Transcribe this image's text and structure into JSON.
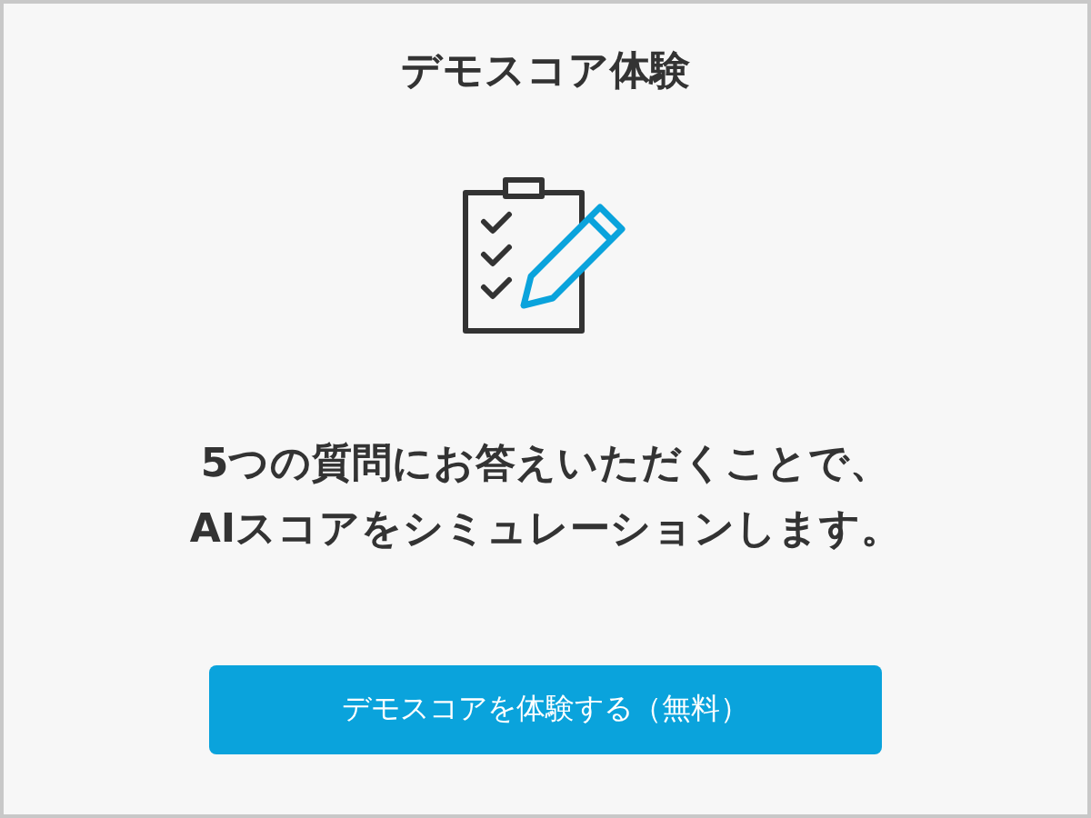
{
  "title": "デモスコア体験",
  "message_lines": [
    "5つの質問にお答えいただくことで、",
    "AIスコアをシミュレーションします。"
  ],
  "button": {
    "label": "デモスコアを体験する（無料）"
  }
}
